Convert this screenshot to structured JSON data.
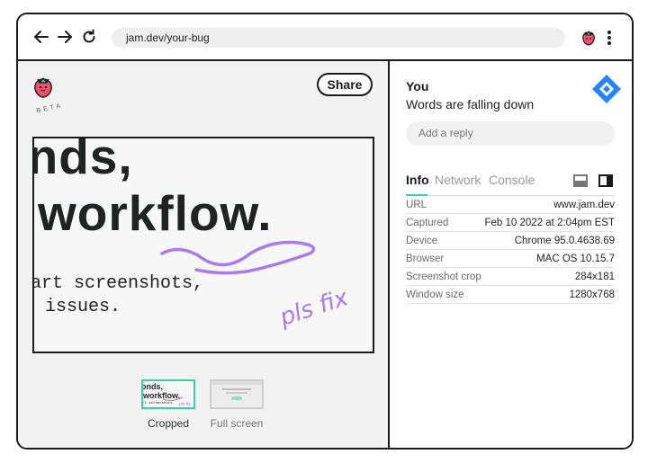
{
  "browser": {
    "url": "jam.dev/your-bug"
  },
  "left": {
    "logo_text": "BETA",
    "share_label": "Share",
    "screenshot": {
      "line1": "onds,",
      "line2": "workflow.",
      "line3": "art screenshots,",
      "line4": " issues.",
      "annotation": "pls fix"
    },
    "thumbnails": [
      {
        "label": "Cropped",
        "selected": true
      },
      {
        "label": "Full screen",
        "selected": false
      }
    ]
  },
  "comment": {
    "author": "You",
    "text": "Words are falling down",
    "reply_placeholder": "Add a reply"
  },
  "tabs": [
    {
      "label": "Info",
      "active": true
    },
    {
      "label": "Network",
      "active": false
    },
    {
      "label": "Console",
      "active": false
    }
  ],
  "info": [
    {
      "key": "URL",
      "value": "www.jam.dev"
    },
    {
      "key": "Captured",
      "value": "Feb 10 2022 at 2:04pm EST"
    },
    {
      "key": "Device",
      "value": "Chrome 95.0.4638.69"
    },
    {
      "key": "Browser",
      "value": "MAC OS 10.15.7"
    },
    {
      "key": "Screenshot crop",
      "value": "284x181"
    },
    {
      "key": "Window size",
      "value": "1280x768"
    }
  ],
  "colors": {
    "accent": "#3ccfa3",
    "annotation": "#a77ce8",
    "jira": "#2684ff"
  }
}
